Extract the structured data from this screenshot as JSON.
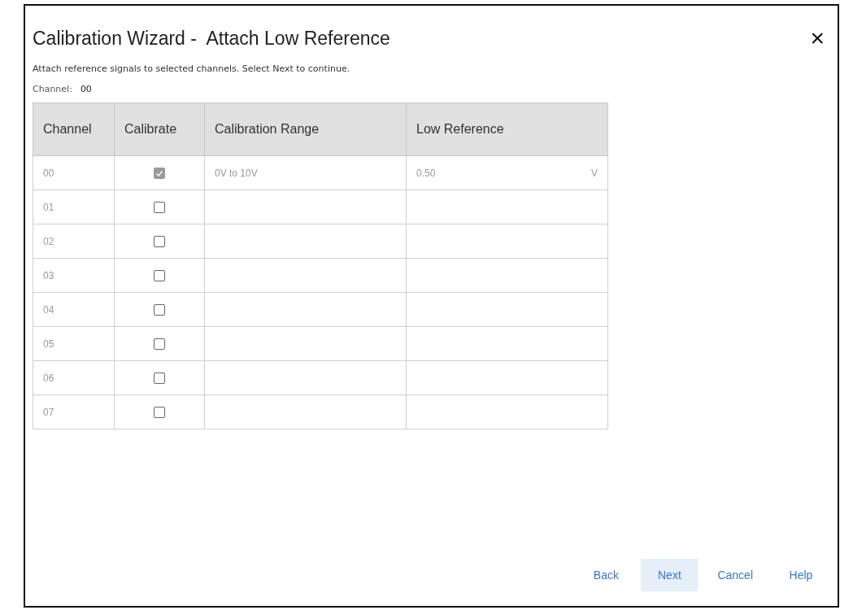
{
  "dialog": {
    "title": "Calibration Wizard -  Attach Low Reference",
    "close": "×",
    "instruction": "Attach reference signals to selected channels. Select Next to continue.",
    "channel_label": "Channel:",
    "channel_value": "00"
  },
  "table": {
    "columns": [
      "Channel",
      "Calibrate",
      "Calibration Range",
      "Low Reference"
    ],
    "rows": [
      {
        "channel": "00",
        "checked": true,
        "range": "0V to 10V",
        "low_reference": "0.50",
        "unit": "V"
      },
      {
        "channel": "01",
        "checked": false
      },
      {
        "channel": "02",
        "checked": false
      },
      {
        "channel": "03",
        "checked": false
      },
      {
        "channel": "04",
        "checked": false
      },
      {
        "channel": "05",
        "checked": false
      },
      {
        "channel": "06",
        "checked": false
      },
      {
        "channel": "07",
        "checked": false
      }
    ]
  },
  "buttons": [
    {
      "label": "Back",
      "focused": false
    },
    {
      "label": "Next",
      "focused": true
    },
    {
      "label": "Cancel",
      "focused": false
    },
    {
      "label": "Help",
      "focused": false
    }
  ]
}
